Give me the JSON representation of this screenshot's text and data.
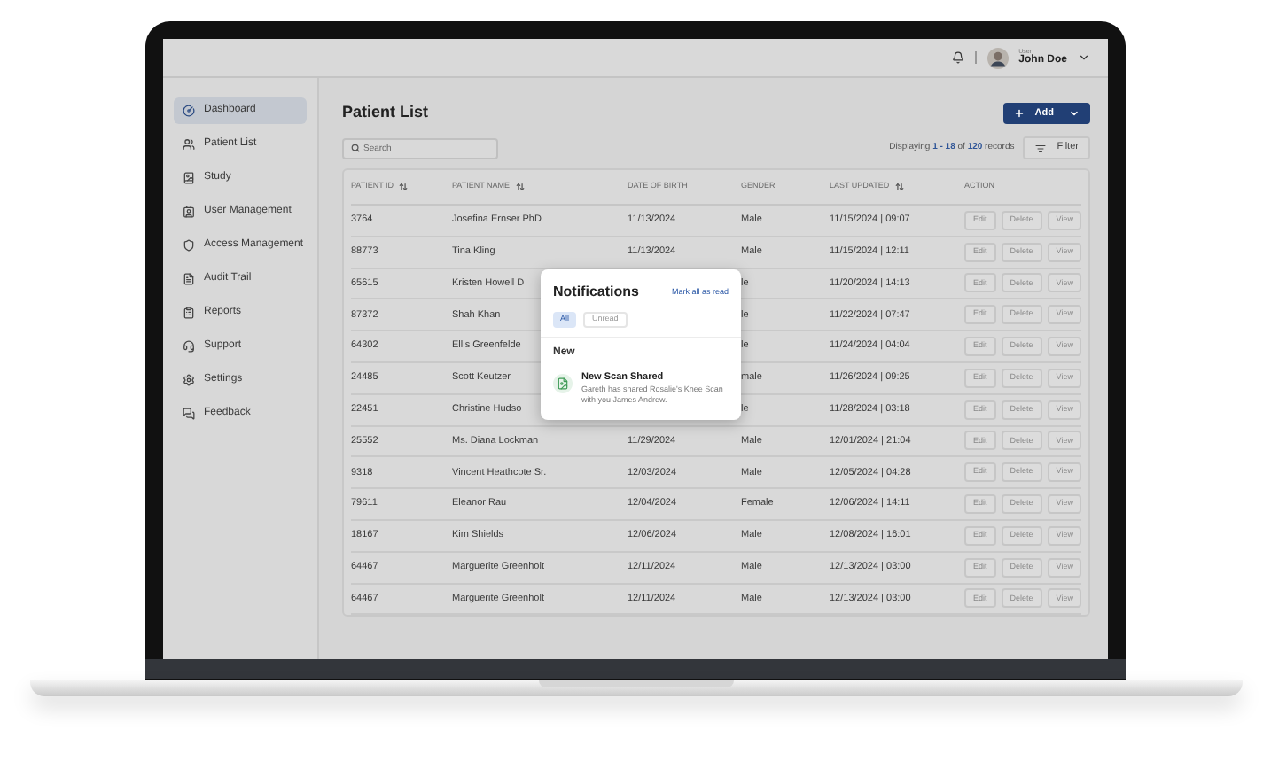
{
  "topbar": {
    "user_role": "User",
    "user_name": "John Doe"
  },
  "sidebar": {
    "items": [
      {
        "label": "Dashboard",
        "selected": true
      },
      {
        "label": "Patient List",
        "selected": false
      },
      {
        "label": "Study",
        "selected": false
      },
      {
        "label": "User Management",
        "selected": false
      },
      {
        "label": "Access Management",
        "selected": false
      },
      {
        "label": "Audit Trail",
        "selected": false
      },
      {
        "label": "Reports",
        "selected": false
      },
      {
        "label": "Support",
        "selected": false
      },
      {
        "label": "Settings",
        "selected": false
      },
      {
        "label": "Feedback",
        "selected": false
      }
    ]
  },
  "page_title": "Patient List",
  "add_button": "Add",
  "search": {
    "placeholder": "Search"
  },
  "records": "Displaying **1 - 18** of **120** records",
  "filter_button": "Filter",
  "table": {
    "columns": [
      {
        "label": "PATIENT ID",
        "sortable": true
      },
      {
        "label": "PATIENT NAME",
        "sortable": true
      },
      {
        "label": "DATE OF BIRTH",
        "sortable": false
      },
      {
        "label": "GENDER",
        "sortable": false
      },
      {
        "label": "LAST UPDATED",
        "sortable": true
      },
      {
        "label": "ACTION",
        "sortable": false
      }
    ],
    "rows": [
      {
        "patient_id": "3764",
        "patient_name": "Josefina Ernser PhD",
        "date_of_birth": "11/13/2024",
        "gender": "Male",
        "last_updated": "11/15/2024 | 09:07",
        "actions": [
          "Edit",
          "Delete",
          "View"
        ]
      },
      {
        "patient_id": "88773",
        "patient_name": "Tina Kling",
        "date_of_birth": "11/13/2024",
        "gender": "Male",
        "last_updated": "11/15/2024 | 12:11",
        "actions": [
          "Edit",
          "Delete",
          "View"
        ]
      },
      {
        "patient_id": "65615",
        "patient_name": "Kristen Howell D",
        "gender": "le",
        "last_updated": "11/20/2024 | 14:13",
        "actions": [
          "Edit",
          "Delete",
          "View"
        ]
      },
      {
        "patient_id": "87372",
        "patient_name": "Shah Khan",
        "gender": "le",
        "last_updated": "11/22/2024 | 07:47",
        "actions": [
          "Edit",
          "Delete",
          "View"
        ]
      },
      {
        "patient_id": "64302",
        "patient_name": "Ellis Greenfelde",
        "gender": "le",
        "last_updated": "11/24/2024 | 04:04",
        "actions": [
          "Edit",
          "Delete",
          "View"
        ]
      },
      {
        "patient_id": "24485",
        "patient_name": "Scott Keutzer",
        "gender": "male",
        "last_updated": "11/26/2024 | 09:25",
        "actions": [
          "Edit",
          "Delete",
          "View"
        ]
      },
      {
        "patient_id": "22451",
        "patient_name": "Christine Hudso",
        "gender": "le",
        "last_updated": "11/28/2024 | 03:18",
        "actions": [
          "Edit",
          "Delete",
          "View"
        ]
      },
      {
        "patient_id": "25552",
        "patient_name": "Ms. Diana Lockman",
        "date_of_birth": "11/29/2024",
        "gender": "Male",
        "last_updated": "12/01/2024 | 21:04",
        "actions": [
          "Edit",
          "Delete",
          "View"
        ]
      },
      {
        "patient_id": "9318",
        "patient_name": "Vincent Heathcote Sr.",
        "date_of_birth": "12/03/2024",
        "gender": "Male",
        "last_updated": "12/05/2024 | 04:28",
        "actions": [
          "Edit",
          "Delete",
          "View"
        ]
      },
      {
        "patient_id": "79611",
        "patient_name": "Eleanor Rau",
        "date_of_birth": "12/04/2024",
        "gender": "Female",
        "last_updated": "12/06/2024 | 14:11",
        "actions": [
          "Edit",
          "Delete",
          "View"
        ]
      },
      {
        "patient_id": "18167",
        "patient_name": "Kim Shields",
        "date_of_birth": "12/06/2024",
        "gender": "Male",
        "last_updated": "12/08/2024 | 16:01",
        "actions": [
          "Edit",
          "Delete",
          "View"
        ]
      },
      {
        "patient_id": "64467",
        "patient_name": "Marguerite Greenholt",
        "date_of_birth": "12/11/2024",
        "gender": "Male",
        "last_updated": "12/13/2024 | 03:00",
        "actions": [
          "Edit",
          "Delete",
          "View"
        ]
      },
      {
        "patient_id": "64467",
        "patient_name": "Marguerite Greenholt",
        "date_of_birth": "12/11/2024",
        "gender": "Male",
        "last_updated": "12/13/2024 | 03:00",
        "actions": [
          "Edit",
          "Delete",
          "View"
        ]
      }
    ]
  },
  "notifications": {
    "title": "Notifications",
    "mark_all": "Mark all as read",
    "tabs": [
      {
        "label": "All",
        "selected": true
      },
      {
        "label": "Unread",
        "selected": false
      }
    ],
    "section": "New",
    "items": [
      {
        "title": "New Scan Shared",
        "body": "Gareth has shared Rosalie's Knee Scan with you James Andrew."
      }
    ]
  }
}
